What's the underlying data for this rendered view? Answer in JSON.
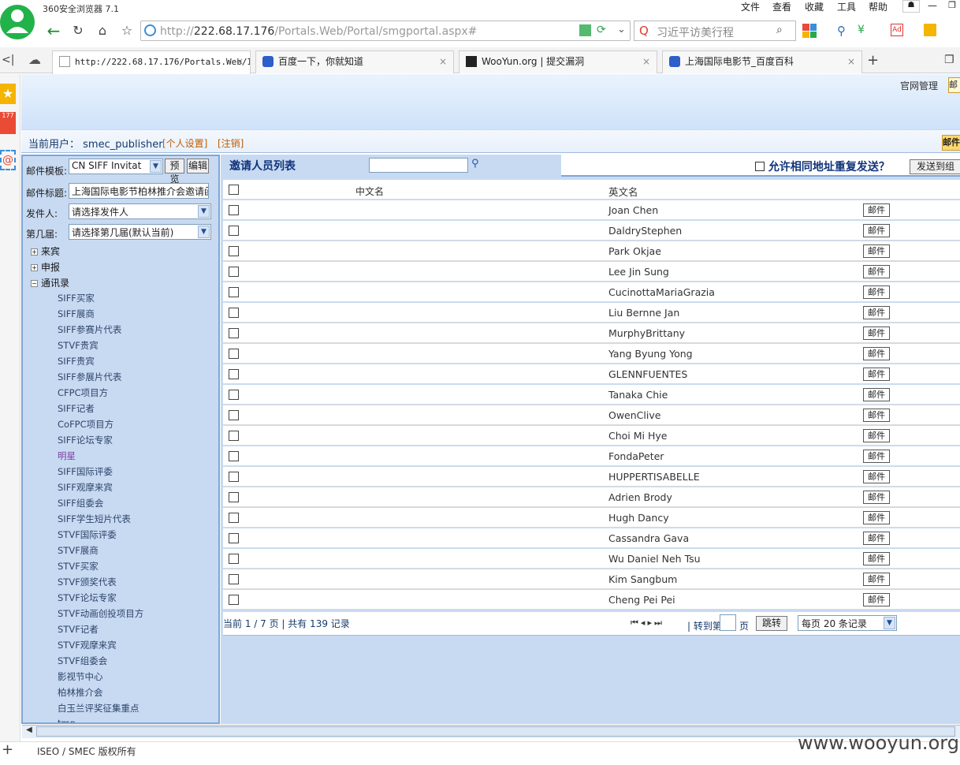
{
  "browser": {
    "app_title": "360安全浏览器 7.1",
    "menu": [
      "文件",
      "查看",
      "收藏",
      "工具",
      "帮助"
    ],
    "address": {
      "protocol": "http://",
      "host": "222.68.17.176",
      "path": "/Portals.Web/Portal/smgportal.aspx#"
    },
    "search_text": "习近平访美行程",
    "tabs": [
      {
        "label": "http://222.68.17.176/Portals.Web/I",
        "active": true
      },
      {
        "label": "百度一下，你就知道",
        "active": false
      },
      {
        "label": "WooYun.org | 提交漏洞",
        "active": false
      },
      {
        "label": "上海国际电影节_百度百科",
        "active": false
      }
    ],
    "badge_count": "177"
  },
  "header": {
    "official_admin": "官网管理",
    "mail_tab": "邮件"
  },
  "userbar": {
    "label": "当前用户：",
    "username": "smec_publisher",
    "personal_settings": "[个人设置]",
    "logout": "[注销]",
    "mail_btn": "邮件"
  },
  "sidebar": {
    "template_label": "邮件模板:",
    "template_value": "CN SIFF Invitat",
    "preview_btn": "预览",
    "edit_btn": "编辑",
    "subject_label": "邮件标题:",
    "subject_value": "上海国际电影节柏林推介会邀请函",
    "sender_label": "发件人:",
    "sender_value": "请选择发件人",
    "session_label": "第几届:",
    "session_value": "请选择第几届(默认当前)",
    "tree": [
      {
        "label": "来宾",
        "expanded": false
      },
      {
        "label": "申报",
        "expanded": false
      },
      {
        "label": "通讯录",
        "expanded": true
      }
    ],
    "contacts": [
      "SIFF买家",
      "SIFF展商",
      "SIFF参赛片代表",
      "STVF贵宾",
      "SIFF贵宾",
      "SIFF参展片代表",
      "CFPC项目方",
      "SIFF记者",
      "CoFPC项目方",
      "SIFF论坛专家",
      "明星",
      "SIFF国际评委",
      "SIFF观摩来宾",
      "SIFF组委会",
      "SIFF学生短片代表",
      "STVF国际评委",
      "STVF展商",
      "STVF买家",
      "STVF颁奖代表",
      "STVF论坛专家",
      "STVF动画创投项目方",
      "STVF记者",
      "STVF观摩来宾",
      "STVF组委会",
      "影视节中心",
      "柏林推介会",
      "白玉兰评奖征集重点",
      "tmp"
    ]
  },
  "main": {
    "title": "邀请人员列表",
    "allow_duplicate": "允许相同地址重复发送？",
    "send_to_group": "发送到组",
    "col_cn": "中文名",
    "col_en": "英文名",
    "mail_label": "邮件",
    "rows": [
      "Joan Chen",
      "DaldryStephen",
      "Park Okjae",
      "Lee Jin Sung",
      "CucinottaMariaGrazia",
      "Liu Bernne Jan",
      "MurphyBrittany",
      "Yang Byung Yong",
      "GLENNFUENTES",
      "Tanaka Chie",
      "OwenClive",
      "Choi Mi Hye",
      "FondaPeter",
      "HUPPERTISABELLE",
      "Adrien Brody",
      "Hugh Dancy",
      "Cassandra Gava",
      "Wu Daniel Neh Tsu",
      "Kim Sangbum",
      "Cheng Pei Pei"
    ],
    "pager": {
      "info": "当前 1 / 7 页 | 共有 139 记录",
      "goto": "| 转到第",
      "page_unit": "页",
      "jump": "跳转",
      "per_page": "每页 20 条记录"
    }
  },
  "footer": {
    "copyright": "ISEO / SMEC 版权所有"
  },
  "watermark": "www.wooyun.org"
}
